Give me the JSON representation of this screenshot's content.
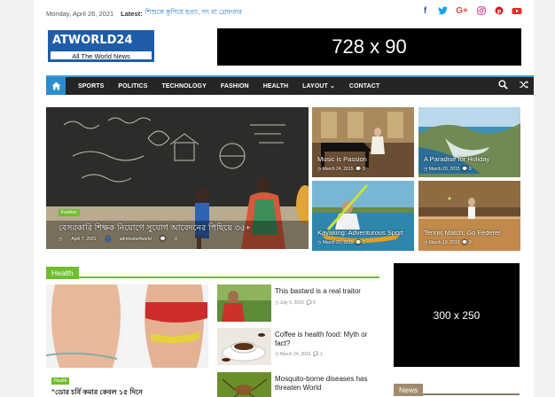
{
  "topbar": {
    "date": "Monday, April 26, 2021",
    "latest_label": "Latest:",
    "latest_headline": "শিশুকে কুপিয়ে হত্যা, সৎ মা গ্রেফতার",
    "social_icons": [
      "facebook-icon",
      "twitter-icon",
      "google-plus-icon",
      "instagram-icon",
      "pinterest-icon",
      "youtube-icon"
    ]
  },
  "header": {
    "logo_title": "ATWORLD24",
    "logo_tagline": "All The World News",
    "banner_ad": "728 x 90"
  },
  "nav": {
    "items": [
      "SPORTS",
      "POLITICS",
      "TECHNOLOGY",
      "FASHION",
      "HEALTH",
      "LAYOUT ⌄",
      "CONTACT"
    ]
  },
  "featured": {
    "main": {
      "category": "Fashion",
      "title": "বেসরকারি শিক্ষক নিয়োগে সুযোগ আবেদনের পিছিয়ে ৩৫+",
      "date": "April 7, 2021",
      "author": "adminatw4world",
      "comments": "0"
    },
    "small": [
      {
        "title": "Music is Passion",
        "date": "March 24, 2015",
        "comments": "0"
      },
      {
        "title": "A Paradise for Holiday",
        "date": "March 20, 2015",
        "comments": "0"
      },
      {
        "title": "Kayaking: Adventurous Sport",
        "date": "March 20, 2015",
        "comments": "0"
      },
      {
        "title": "Tennis Match: Go Federer",
        "date": "March 19, 2015",
        "comments": "0"
      }
    ]
  },
  "health": {
    "section_label": "Health",
    "feature_category": "Health",
    "feature_title": "“ডোর চর্বি কমার কেবল ১৫ দিনে",
    "list": [
      {
        "title": "This bastard is a real traitor",
        "date": "July 9, 2020",
        "comments": "0"
      },
      {
        "title": "Coffee is health food: Myth or fact?",
        "date": "March 24, 2015",
        "comments": "1"
      },
      {
        "title": "Mosquito-borne diseases has threaten World",
        "date": "",
        "comments": ""
      }
    ]
  },
  "sidebar": {
    "banner_ad": "300 x 250",
    "news_label": "News"
  },
  "colors": {
    "accent": "#6fbf2c",
    "nav_bg": "#252525",
    "nav_home": "#2a8ccd",
    "logo_blue": "#1f5da8"
  }
}
